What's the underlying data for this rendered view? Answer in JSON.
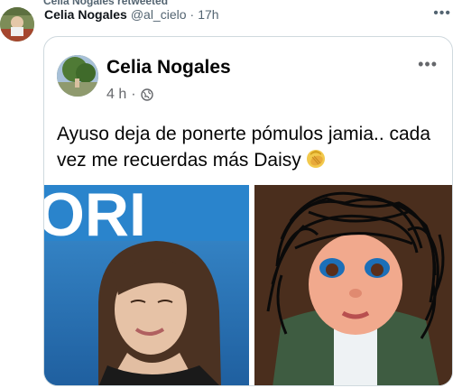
{
  "retweet": {
    "label": "Celia Nogales retweeted"
  },
  "tweet": {
    "author_name": "Celia Nogales",
    "handle": "@al_cielo",
    "separator": "·",
    "time": "17h",
    "more_icon": "more-horizontal-icon"
  },
  "fb_post": {
    "author_name": "Celia Nogales",
    "time": "4 h",
    "separator": "·",
    "privacy_icon": "globe-icon",
    "more_icon": "more-horizontal-icon",
    "text": "Ayuso deja de ponerte pómulos  jamia.. cada vez me recuerdas más Daisy",
    "emoji": "face-palm-emoji",
    "photo_left_text": "ORI"
  },
  "colors": {
    "name": "#0f1419",
    "muted": "#536471",
    "card_border": "#cfd9de",
    "fb_muted": "#65676b"
  }
}
